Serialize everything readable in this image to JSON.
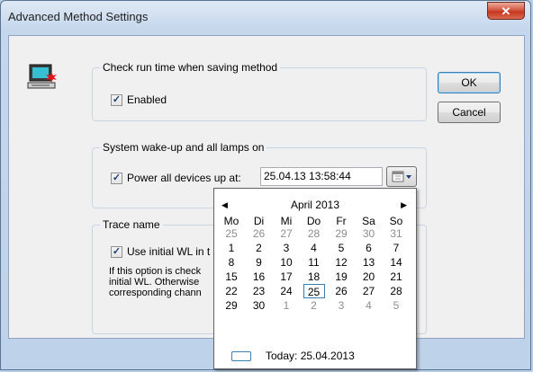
{
  "window": {
    "title": "Advanced Method Settings",
    "close_glyph": "✕"
  },
  "groups": {
    "runtime": {
      "title": "Check run time when saving method",
      "checkbox_label": "Enabled",
      "checked": true
    },
    "wakeup": {
      "title": "System wake-up and all lamps on",
      "checkbox_label": "Power all devices up at:",
      "checked": true,
      "datetime_value": "25.04.13 13:58:44"
    },
    "trace": {
      "title": "Trace name",
      "checkbox_label": "Use initial WL in t",
      "checked": true,
      "description": "If this option is check\ninitial WL. Otherwise \ncorresponding chann"
    }
  },
  "buttons": {
    "ok": "OK",
    "cancel": "Cancel"
  },
  "calendar": {
    "month_label": "April 2013",
    "prev_glyph": "◀",
    "next_glyph": "▶",
    "weekdays": [
      "Mo",
      "Di",
      "Mi",
      "Do",
      "Fr",
      "Sa",
      "So"
    ],
    "weeks": [
      [
        {
          "d": "25",
          "o": true
        },
        {
          "d": "26",
          "o": true
        },
        {
          "d": "27",
          "o": true
        },
        {
          "d": "28",
          "o": true
        },
        {
          "d": "29",
          "o": true
        },
        {
          "d": "30",
          "o": true
        },
        {
          "d": "31",
          "o": true
        }
      ],
      [
        {
          "d": "1"
        },
        {
          "d": "2"
        },
        {
          "d": "3"
        },
        {
          "d": "4"
        },
        {
          "d": "5"
        },
        {
          "d": "6"
        },
        {
          "d": "7"
        }
      ],
      [
        {
          "d": "8"
        },
        {
          "d": "9"
        },
        {
          "d": "10"
        },
        {
          "d": "11"
        },
        {
          "d": "12"
        },
        {
          "d": "13"
        },
        {
          "d": "14"
        }
      ],
      [
        {
          "d": "15"
        },
        {
          "d": "16"
        },
        {
          "d": "17"
        },
        {
          "d": "18"
        },
        {
          "d": "19"
        },
        {
          "d": "20"
        },
        {
          "d": "21"
        }
      ],
      [
        {
          "d": "22"
        },
        {
          "d": "23"
        },
        {
          "d": "24"
        },
        {
          "d": "25",
          "t": true
        },
        {
          "d": "26"
        },
        {
          "d": "27"
        },
        {
          "d": "28"
        }
      ],
      [
        {
          "d": "29"
        },
        {
          "d": "30"
        },
        {
          "d": "1",
          "o": true
        },
        {
          "d": "2",
          "o": true
        },
        {
          "d": "3",
          "o": true
        },
        {
          "d": "4",
          "o": true
        },
        {
          "d": "5",
          "o": true
        }
      ]
    ],
    "today_label": "Today: 25.04.2013"
  },
  "icons": {
    "app": "computer-alert-icon",
    "calendar": "calendar-dropdown-icon"
  },
  "colors": {
    "accent": "#3c7fb1",
    "close": "#c7361f",
    "frame": "#bed2e9"
  }
}
